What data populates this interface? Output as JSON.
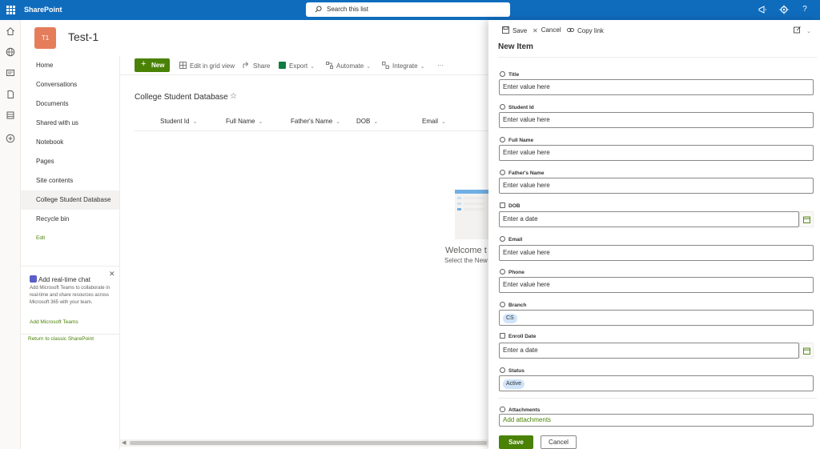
{
  "suite": {
    "brand": "SharePoint",
    "search_placeholder": "Search this list"
  },
  "site": {
    "logo_initials": "T1",
    "title": "Test-1"
  },
  "leftnav": {
    "items": [
      {
        "label": "Home"
      },
      {
        "label": "Conversations"
      },
      {
        "label": "Documents"
      },
      {
        "label": "Shared with us"
      },
      {
        "label": "Notebook"
      },
      {
        "label": "Pages"
      },
      {
        "label": "Site contents"
      },
      {
        "label": "College Student Database"
      },
      {
        "label": "Recycle bin"
      },
      {
        "label": "Edit"
      }
    ],
    "selected": "College Student Database",
    "chat": {
      "title": "Add real-time chat",
      "body": "Add Microsoft Teams to collaborate in real-time and share resources across Microsoft 365 with your team.",
      "link": "Add Microsoft Teams"
    },
    "classic_link": "Return to classic SharePoint"
  },
  "commandbar": {
    "new": "New",
    "edit_grid": "Edit in grid view",
    "share": "Share",
    "export": "Export",
    "automate": "Automate",
    "integrate": "Integrate",
    "more": "···"
  },
  "list": {
    "title": "College Student Database",
    "columns": [
      "Student Id",
      "Full Name",
      "Father's Name",
      "DOB",
      "Email"
    ],
    "empty_title": "Welcome t",
    "empty_sub": "Select the New"
  },
  "panel": {
    "save": "Save",
    "cancel": "Cancel",
    "copy_link": "Copy link",
    "title": "New Item",
    "fields": {
      "title": {
        "label": "Title",
        "placeholder": "Enter value here"
      },
      "student_id": {
        "label": "Student Id",
        "placeholder": "Enter value here"
      },
      "full_name": {
        "label": "Full Name",
        "placeholder": "Enter value here"
      },
      "fathers_name": {
        "label": "Father's Name",
        "placeholder": "Enter value here"
      },
      "dob": {
        "label": "DOB",
        "placeholder": "Enter a date"
      },
      "email": {
        "label": "Email",
        "placeholder": "Enter value here"
      },
      "phone": {
        "label": "Phone",
        "placeholder": "Enter value here"
      },
      "branch": {
        "label": "Branch",
        "value": "CS"
      },
      "enroll_date": {
        "label": "Enroll Date",
        "placeholder": "Enter a date"
      },
      "status": {
        "label": "Status",
        "value": "Active"
      }
    },
    "attachments": {
      "label": "Attachments",
      "link": "Add attachments"
    },
    "footer": {
      "save": "Save",
      "cancel": "Cancel"
    }
  },
  "colors": {
    "suitebar": "#0f6cbd",
    "accent": "#498205",
    "logo": "#e57d5b"
  }
}
